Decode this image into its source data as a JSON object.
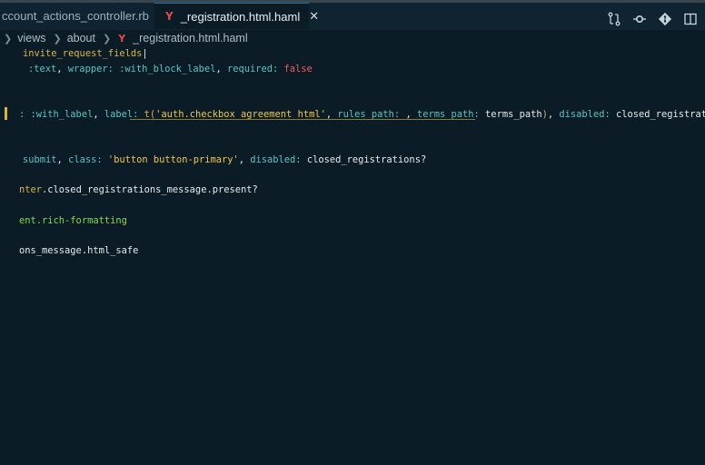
{
  "tabs": [
    {
      "label": "ccount_actions_controller.rb",
      "active": false
    },
    {
      "label": "_registration.html.haml",
      "active": true
    }
  ],
  "tab_close_glyph": "✕",
  "haml_glyph": "Y",
  "breadcrumb": {
    "items": [
      "views",
      "about",
      "_registration.html.haml"
    ]
  },
  "toolbar_icons": [
    "compare-changes-icon",
    "git-lens-icon",
    "source-control-icon",
    "split-editor-icon"
  ],
  "code": {
    "l1": {
      "a": "invite_request_fields",
      "b": "|"
    },
    "l2": {
      "a": ":text",
      "b": ", ",
      "c": "wrapper:",
      "d": " :with_block_label",
      "e": ", ",
      "f": "required:",
      "g": " false"
    },
    "l3": {
      "a": ": :with_label",
      "b": ", ",
      "c": "label:",
      "d": " t(",
      "e": "'auth.checkbox_agreement_html'",
      "f": ", ",
      "g": "rules_path:",
      "h": " , ",
      "i": "terms_path:",
      "j": " terms_path",
      "k": ")",
      "l": ", ",
      "m": "disabled:",
      "n": " closed_registrations?"
    },
    "l4": {
      "a": "submit",
      "b": ", ",
      "c": "class:",
      "d": " 'button button-primary'",
      "e": ", ",
      "f": "disabled:",
      "g": " closed_registrations?"
    },
    "l5": {
      "a": "nter",
      "b": ".closed_registrations_message.present?"
    },
    "l6": {
      "a": "ent.rich-formatting"
    },
    "l7": {
      "a": "ons_message.html_safe"
    }
  },
  "colors": {
    "background": "#0b1c26",
    "tab_active_border": "#1e6fa8",
    "gutter_modified": "#e0b52e",
    "haml_icon": "#e5484d"
  }
}
